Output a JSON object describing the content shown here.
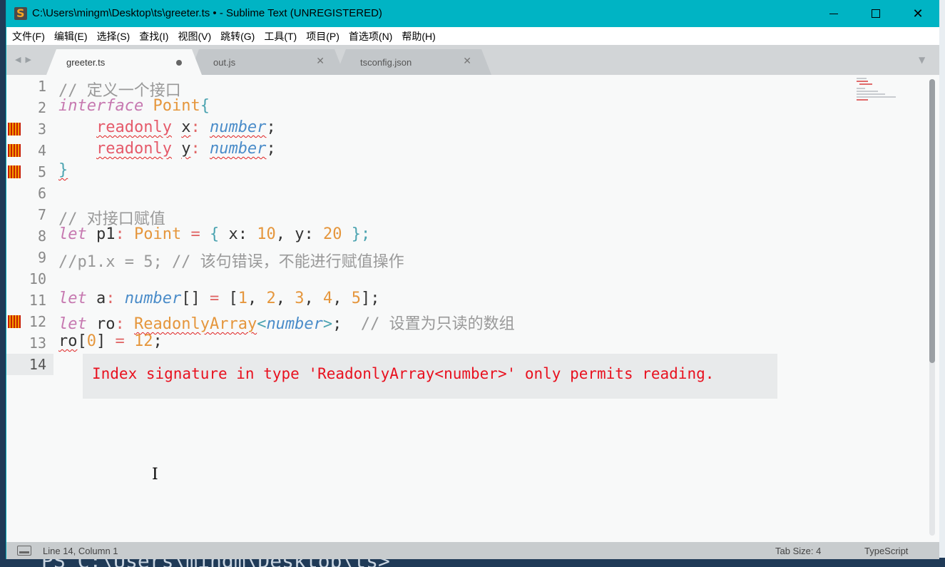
{
  "window": {
    "title": "C:\\Users\\mingm\\Desktop\\ts\\greeter.ts • - Sublime Text (UNREGISTERED)",
    "controls": [
      "minimize",
      "maximize",
      "close"
    ]
  },
  "menu": [
    "文件(F)",
    "编辑(E)",
    "选择(S)",
    "查找(I)",
    "视图(V)",
    "跳转(G)",
    "工具(T)",
    "项目(P)",
    "首选项(N)",
    "帮助(H)"
  ],
  "tabs": [
    {
      "label": "greeter.ts",
      "active": true,
      "dirty": true
    },
    {
      "label": "out.js",
      "active": false,
      "dirty": false
    },
    {
      "label": "tsconfig.json",
      "active": false,
      "dirty": false
    }
  ],
  "editor": {
    "line_numbers": [
      "1",
      "2",
      "3",
      "4",
      "5",
      "6",
      "7",
      "8",
      "9",
      "10",
      "11",
      "12",
      "13",
      "14"
    ],
    "error_lines": [
      3,
      4,
      5,
      12
    ],
    "current_line": 14,
    "lines": {
      "l1": "// 定义一个接口",
      "l2_kw": "interface",
      "l2_name": "Point",
      "l2_brace": "{",
      "l3_indent": "    ",
      "l3_kw": "readonly",
      "l3_id": "x",
      "l3_colon": ":",
      "l3_type": "number",
      "l3_semi": ";",
      "l4_indent": "    ",
      "l4_kw": "readonly",
      "l4_id": "y",
      "l4_colon": ":",
      "l4_type": "number",
      "l4_semi": ";",
      "l5": "}",
      "l7": "// 对接口赋值",
      "l8_kw": "let",
      "l8_id": "p1",
      "l8_colon": ":",
      "l8_type": "Point",
      "l8_eq": "=",
      "l8_open": "{",
      "l8_x": "x:",
      "l8_v1": "10",
      "l8_comma": ",",
      "l8_y": "y:",
      "l8_v2": "20",
      "l8_close": "};",
      "l9": "//p1.x = 5; // 该句错误，不能进行赋值操作",
      "l11_kw": "let",
      "l11_id": "a",
      "l11_colon": ":",
      "l11_type": "number",
      "l11_arr": "[]",
      "l11_eq": "=",
      "l11_open": "[",
      "l11_n1": "1",
      "l11_n2": "2",
      "l11_n3": "3",
      "l11_n4": "4",
      "l11_n5": "5",
      "l11_close": "];",
      "l11_sep": ", ",
      "l12_kw": "let",
      "l12_id": "ro",
      "l12_colon": ":",
      "l12_type": "ReadonlyArray",
      "l12_lt": "<",
      "l12_generic": "number",
      "l12_gt": ">",
      "l12_semi": ";",
      "l12_comment": "// 设置为只读的数组",
      "l13_id": "ro",
      "l13_open": "[",
      "l13_idx": "0",
      "l13_close": "]",
      "l13_eq": "=",
      "l13_val": "12",
      "l13_semi": ";"
    },
    "error_message": "Index signature in type 'ReadonlyArray<number>' only permits reading."
  },
  "status": {
    "position": "Line 14, Column 1",
    "tab_size": "Tab Size: 4",
    "syntax": "TypeScript"
  },
  "background_terminal_text": "PS C:\\Users\\mingm\\Desktop\\ts>"
}
